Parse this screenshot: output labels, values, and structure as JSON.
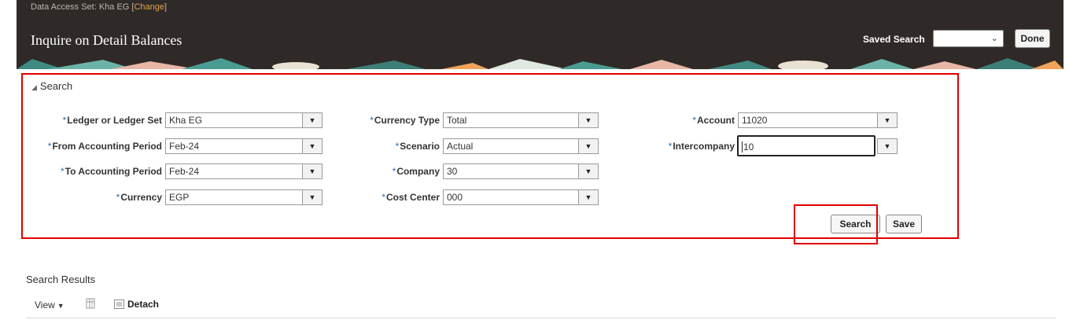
{
  "header": {
    "data_access_label": "Data Access Set: Kha EG",
    "change_link": "Change",
    "title": "Inquire on Detail Balances",
    "saved_search_label": "Saved Search",
    "saved_search_value": "",
    "done_label": "Done"
  },
  "search": {
    "toggle_label": "Search",
    "required_marker": "*",
    "fields": {
      "ledger": {
        "label": "Ledger or Ledger Set",
        "value": "Kha EG"
      },
      "from_period": {
        "label": "From Accounting Period",
        "value": "Feb-24"
      },
      "to_period": {
        "label": "To Accounting Period",
        "value": "Feb-24"
      },
      "currency": {
        "label": "Currency",
        "value": "EGP"
      },
      "currency_type": {
        "label": "Currency Type",
        "value": "Total"
      },
      "scenario": {
        "label": "Scenario",
        "value": "Actual"
      },
      "company": {
        "label": "Company",
        "value": "30"
      },
      "cost_center": {
        "label": "Cost Center",
        "value": "000"
      },
      "account": {
        "label": "Account",
        "value": "11020"
      },
      "intercompany": {
        "label": "Intercompany",
        "value": "10"
      }
    },
    "search_button": "Search",
    "save_button": "Save"
  },
  "results": {
    "title": "Search Results",
    "view_menu": "View",
    "detach_label": "Detach"
  },
  "colors": {
    "header_bg": "#2f2a27",
    "highlight": "#e00000",
    "required": "#2a6fb0",
    "change_link": "#e0a44a"
  }
}
